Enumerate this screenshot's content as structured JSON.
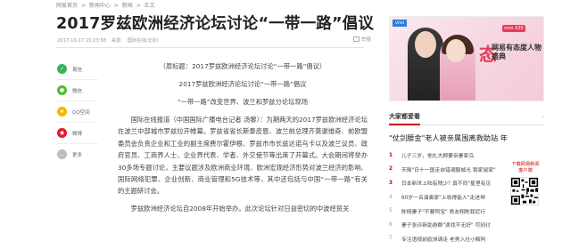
{
  "breadcrumb": [
    "网易首页",
    ">",
    "新闻中心",
    ">",
    "新闻",
    ">",
    "正文"
  ],
  "article": {
    "title": "2017罗兹欧洲经济论坛讨论“一带一路”倡议",
    "meta": [
      "2017-10-17 15:23:58",
      "来源:",
      "国际在线(北京)"
    ],
    "print_label": "举报",
    "paragraphs": [
      "（原标题：2017罗兹欧洲经济论坛讨论“一带一路”倡议）",
      "2017罗兹欧洲经济论坛讨论“一带一路”倡议",
      "“一带一路”改变世界、波兰和罗兹分论坛现场",
      "国际在线报道（中国国际广播电台记者 汤黎）：为期两天的2017罗兹欧洲经济论坛在波兰中部城市罗兹拉开帷幕。罗兹省省长斯泰皮恩、波兰前总理齐莫谢维奇、前欧盟委员会负责企业和工业的副主席费尔霍伊根、罗兹市市长兹达诺乌卡以及波兰议员、政府官员、工商界人士、企业界代表、学者、外交使节等出席了开幕式。大会期间将举办30多场专题讨论，主要议题涉及欧洲商业环境、欧洲宏观经济形势对波兰经济的影响、国际网络犯罪、企业创新、商业管理和5G技术等，其中还包括与中国“一带一路”有关的主题研讨会。",
      "罗兹欧洲经济论坛自2008年开始举办。此次论坛针对日益密切的中波经贸关"
    ]
  },
  "share": [
    {
      "name": "易信",
      "icon": "yixin-icon",
      "color": "#35b558"
    },
    {
      "name": "微信",
      "icon": "wechat-icon",
      "color": "#4cbf36"
    },
    {
      "name": "QQ空间",
      "icon": "qzone-icon",
      "color": "#f5b800"
    },
    {
      "name": "微博",
      "icon": "weibo-icon",
      "color": "#e6162d"
    },
    {
      "name": "更多",
      "icon": "more-icon",
      "color": "#bdbdbd"
    }
  ],
  "ad": {
    "brand": "vivo",
    "big": "态",
    "tag": "vivo X20",
    "slogan": "网易有态度人物盛典"
  },
  "recommend": {
    "title": "大家都爱看",
    "more": "›",
    "top": "\"仗剑腰金\"老人被亲属围离救助站 年",
    "items": [
      {
        "num": "1",
        "hot": true,
        "text": "儿子三岁，他扎大顾要亲妻家鸟"
      },
      {
        "num": "2",
        "hot": true,
        "text": "天降\"日十一国走自错调服城光 我家鼠家\""
      },
      {
        "num": "3",
        "hot": true,
        "text": "日本新世上陆有残少? 真不同\"星里有见"
      },
      {
        "num": "4",
        "hot": false,
        "text": "60岁一名演奏家\"上吸得能人\"走进坤"
      },
      {
        "num": "5",
        "hot": false,
        "text": "陈翔妻子\"不要阿宝\" 男友翔陈我尼行"
      },
      {
        "num": "6",
        "hot": false,
        "text": "妻子张评新助游群\"滴找不无好\" 可别讨"
      },
      {
        "num": "7",
        "hot": false,
        "text": "专注语视前欧洲调走 老男入社小解判"
      }
    ]
  },
  "qr": {
    "label": "下载网易新闻客户端"
  }
}
